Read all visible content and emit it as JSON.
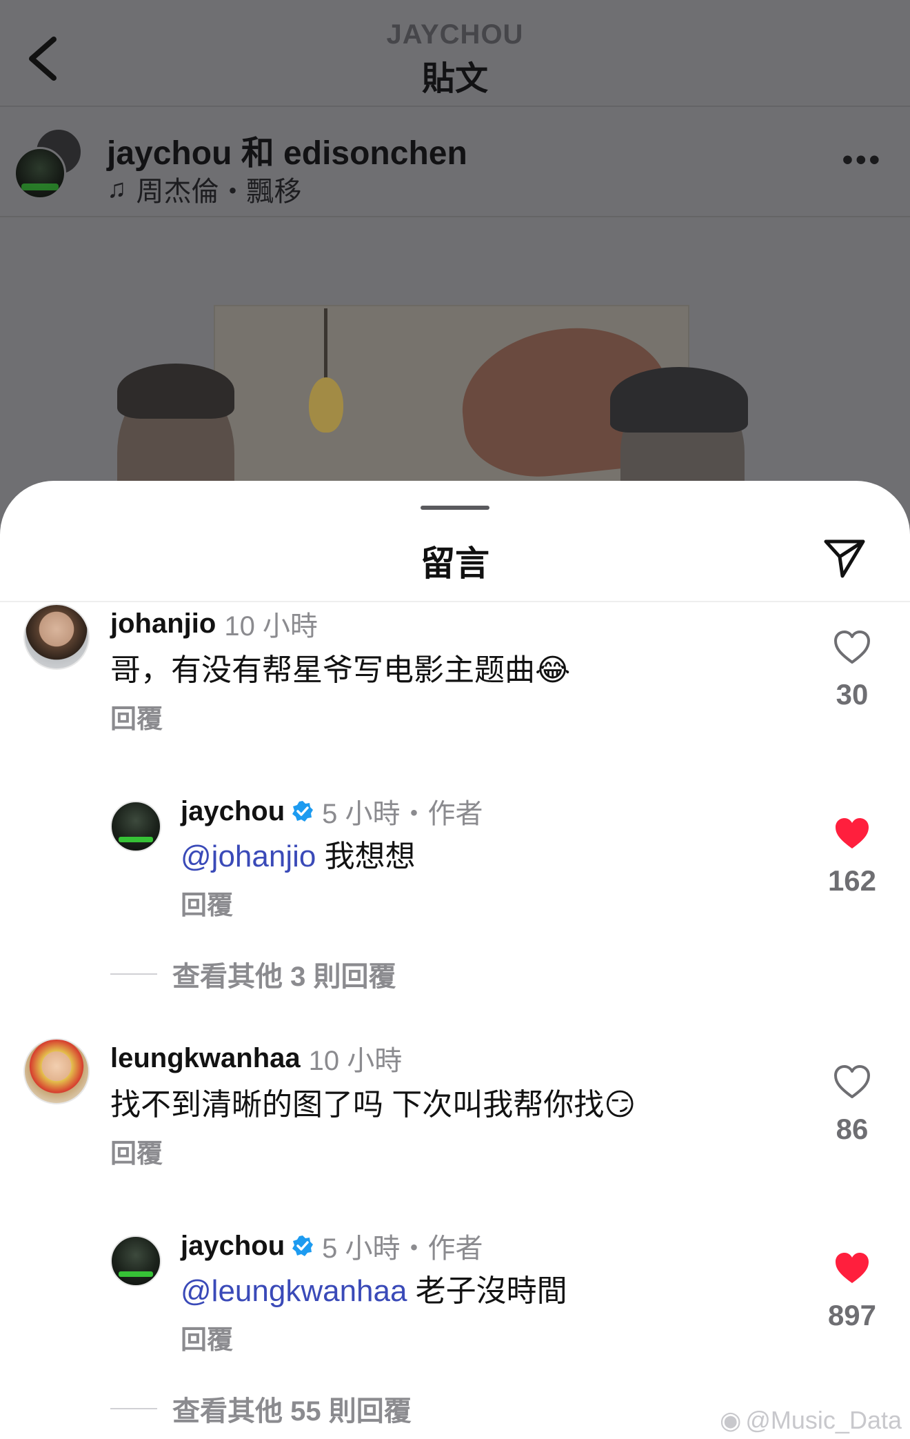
{
  "header": {
    "account": "JAYCHOU",
    "title": "貼文"
  },
  "post": {
    "authors": "jaychou 和 edisonchen",
    "music": "周杰倫・飄移",
    "more_icon": "more-horizontal-icon"
  },
  "sheet": {
    "title": "留言",
    "share_icon": "send-icon"
  },
  "comments": [
    {
      "username": "johanjio",
      "time": "10 小時",
      "text": "哥，有没有帮星爷写电影主题曲",
      "emoji": "😂",
      "reply_label": "回覆",
      "likes": "30",
      "liked": false,
      "replies": [
        {
          "username": "jaychou",
          "verified": true,
          "meta": "5 小時・作者",
          "mention": "@johanjio",
          "text": " 我想想",
          "reply_label": "回覆",
          "likes": "162",
          "liked": true
        }
      ],
      "more_replies": "查看其他 3 則回覆"
    },
    {
      "username": "leungkwanhaa",
      "time": "10 小時",
      "text": "找不到清晰的图了吗 下次叫我帮你找",
      "emoji": "😏",
      "reply_label": "回覆",
      "likes": "86",
      "liked": false,
      "replies": [
        {
          "username": "jaychou",
          "verified": true,
          "meta": "5 小時・作者",
          "mention": "@leungkwanhaa",
          "text": " 老子沒時間",
          "reply_label": "回覆",
          "likes": "897",
          "liked": true
        }
      ],
      "more_replies": "查看其他 55 則回覆"
    }
  ],
  "watermark": "@Music_Data",
  "colors": {
    "like_active": "#ff1f3d",
    "mention": "#3a4ab8",
    "verified": "#1d9bf0",
    "secondary_text": "#8b8b8f"
  }
}
